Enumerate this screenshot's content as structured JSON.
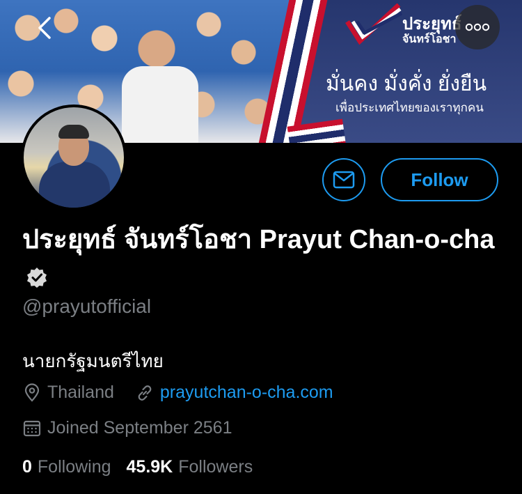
{
  "banner": {
    "brand_line1": "ประยุทธ์",
    "brand_line2": "จันทร์โอชา",
    "slogan": "มั่นคง มั่งคั่ง ยั่งยืน",
    "sub_slogan": "เพื่อประเทศไทยของเราทุกคน"
  },
  "nav": {
    "back_icon": "chevron-left-icon",
    "more_icon": "more-dots-icon"
  },
  "actions": {
    "message_icon": "mail-icon",
    "follow_label": "Follow"
  },
  "profile": {
    "display_name": "ประยุทธ์ จันทร์โอชา Prayut Chan-o-cha",
    "handle": "@prayutofficial",
    "bio": "นายกรัฐมนตรีไทย",
    "location": "Thailand",
    "website": "prayutchan-o-cha.com",
    "joined": "Joined September 2561",
    "following_count": "0",
    "following_label": "Following",
    "followers_count": "45.9K",
    "followers_label": "Followers"
  },
  "colors": {
    "background": "#000000",
    "accent": "#1d9bf0",
    "secondary_text": "#7b7f84"
  }
}
